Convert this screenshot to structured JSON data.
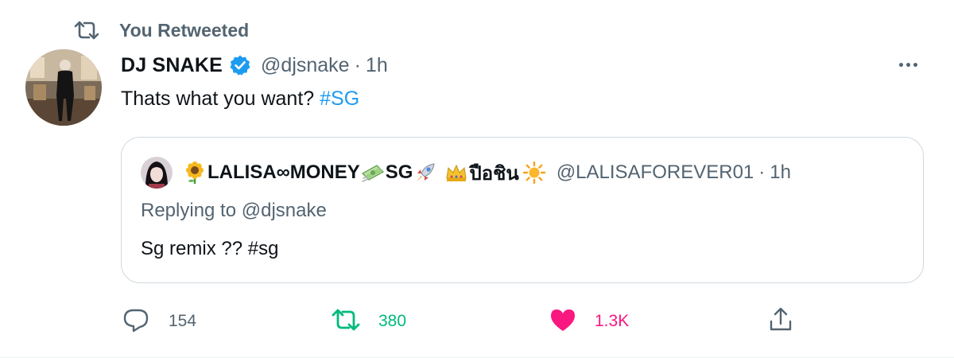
{
  "retweet_banner": {
    "label": "You Retweeted"
  },
  "author": {
    "display_name": "DJ SNAKE",
    "handle": "@djsnake",
    "time": "1h",
    "verified": true
  },
  "tweet": {
    "text": "Thats what you want? ",
    "hashtag": "#SG"
  },
  "quoted": {
    "name_parts": [
      "LALISA∞MONEY",
      "SG",
      "ปือชิน"
    ],
    "name_emoji_icons": [
      "sunflower-icon",
      "money-icon",
      "rocket-icon",
      "crown-icon",
      "sun-icon"
    ],
    "handle": "@LALISAFOREVER01",
    "time": "1h",
    "replying_to": "Replying to @djsnake",
    "text": "Sg remix ?? #sg"
  },
  "actions": {
    "reply_count": "154",
    "retweet_count": "380",
    "like_count": "1.3K"
  },
  "colors": {
    "link_blue": "#1d9bf0",
    "retweet_green": "#00ba7c",
    "like_pink": "#f91880",
    "secondary_text": "#536471"
  }
}
